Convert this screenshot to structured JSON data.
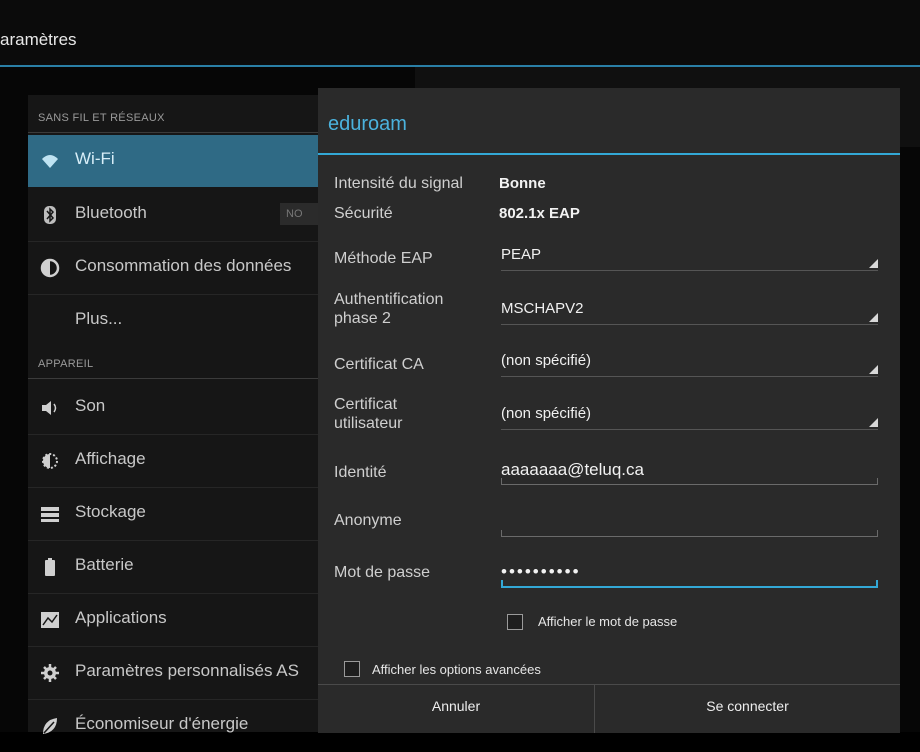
{
  "header": {
    "title": "aramètres"
  },
  "sidebar": {
    "section_wireless": "SANS FIL ET RÉSEAUX",
    "section_device": "APPAREIL",
    "items": [
      {
        "label": "Wi-Fi",
        "icon": "wifi-icon"
      },
      {
        "label": "Bluetooth",
        "icon": "bluetooth-icon",
        "toggle": "NO"
      },
      {
        "label": "Consommation des données",
        "icon": "data-usage-icon"
      },
      {
        "label": "Plus...",
        "icon": ""
      },
      {
        "label": "Son",
        "icon": "sound-icon"
      },
      {
        "label": "Affichage",
        "icon": "display-icon"
      },
      {
        "label": "Stockage",
        "icon": "storage-icon"
      },
      {
        "label": "Batterie",
        "icon": "battery-icon"
      },
      {
        "label": "Applications",
        "icon": "apps-icon"
      },
      {
        "label": "Paramètres personnalisés AS",
        "icon": "gear-icon"
      },
      {
        "label": "Économiseur d'énergie",
        "icon": "leaf-icon"
      }
    ]
  },
  "dialog": {
    "title": "eduroam",
    "signal_label": "Intensité du signal",
    "signal_value": "Bonne",
    "security_label": "Sécurité",
    "security_value": "802.1x EAP",
    "eap_label": "Méthode EAP",
    "eap_value": "PEAP",
    "phase2_label_1": "Authentification",
    "phase2_label_2": "phase 2",
    "phase2_value": "MSCHAPV2",
    "ca_label": "Certificat CA",
    "ca_value": "(non spécifié)",
    "usercert_label_1": "Certificat",
    "usercert_label_2": "utilisateur",
    "usercert_value": "(non spécifié)",
    "identity_label": "Identité",
    "identity_value": "aaaaaaa@teluq.ca",
    "anon_label": "Anonyme",
    "anon_value": "",
    "password_label": "Mot de passe",
    "password_value": "••••••••••",
    "show_password_label": "Afficher le mot de passe",
    "advanced_label": "Afficher les options avancées",
    "cancel_label": "Annuler",
    "connect_label": "Se connecter"
  },
  "colors": {
    "accent": "#33a8d6",
    "selected_row": "#2f6a85",
    "dialog_bg": "#2a2a2a"
  }
}
